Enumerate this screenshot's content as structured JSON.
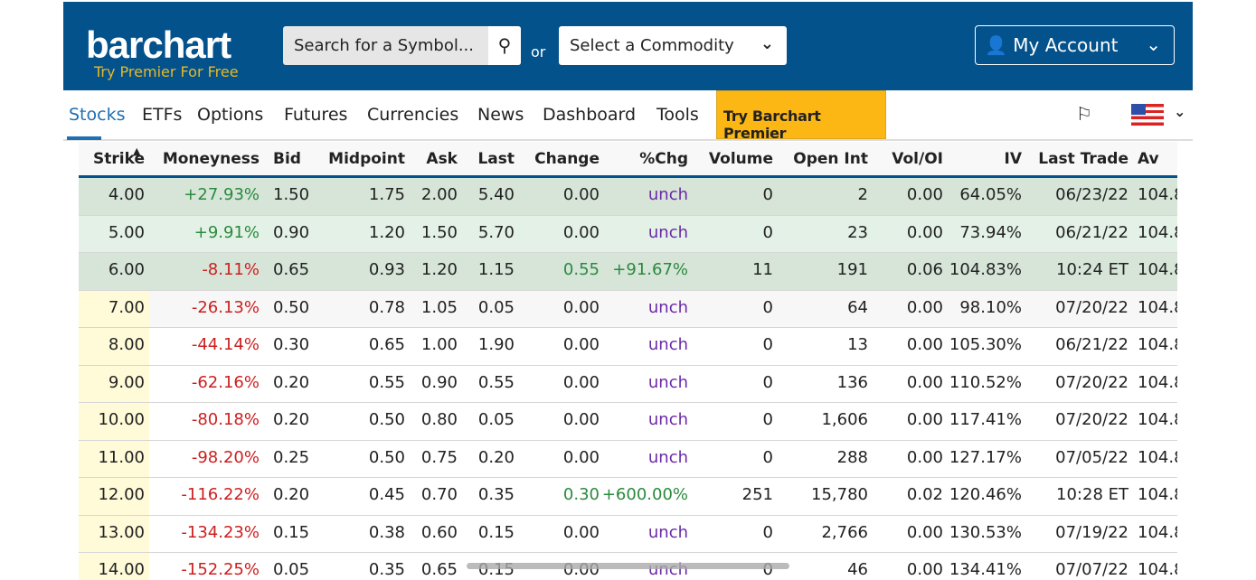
{
  "header": {
    "logo": "barchart",
    "tagline": "Try Premier For Free",
    "search_placeholder": "Search for a Symbol...",
    "or": "or",
    "commodity": "Select a Commodity",
    "account": "My Account"
  },
  "nav": {
    "items": [
      "Stocks",
      "ETFs",
      "Options",
      "Futures",
      "Currencies",
      "News",
      "Dashboard",
      "Tools"
    ],
    "premier": "Try Barchart Premier",
    "active": "Stocks"
  },
  "colors": {
    "brand": "#04528c",
    "premier": "#fdb714",
    "positive": "#2a8a3e",
    "negative": "#cc1f1f",
    "unch": "#6a2aa8"
  },
  "table": {
    "columns": [
      "Strike",
      "Moneyness",
      "Bid",
      "Midpoint",
      "Ask",
      "Last",
      "Change",
      "%Chg",
      "Volume",
      "Open Int",
      "Vol/OI",
      "IV",
      "Last Trade",
      "Av"
    ],
    "sort": "Strike ascending",
    "rows": [
      [
        "4.00",
        "+27.93%",
        "1.50",
        "1.75",
        "2.00",
        "5.40",
        "0.00",
        "unch",
        "0",
        "2",
        "0.00",
        "64.05%",
        "06/23/22",
        "104.8"
      ],
      [
        "5.00",
        "+9.91%",
        "0.90",
        "1.20",
        "1.50",
        "5.70",
        "0.00",
        "unch",
        "0",
        "23",
        "0.00",
        "73.94%",
        "06/21/22",
        "104.8"
      ],
      [
        "6.00",
        "-8.11%",
        "0.65",
        "0.93",
        "1.20",
        "1.15",
        "0.55",
        "+91.67%",
        "11",
        "191",
        "0.06",
        "104.83%",
        "10:24 ET",
        "104.8"
      ],
      [
        "7.00",
        "-26.13%",
        "0.50",
        "0.78",
        "1.05",
        "0.05",
        "0.00",
        "unch",
        "0",
        "64",
        "0.00",
        "98.10%",
        "07/20/22",
        "104.8"
      ],
      [
        "8.00",
        "-44.14%",
        "0.30",
        "0.65",
        "1.00",
        "1.90",
        "0.00",
        "unch",
        "0",
        "13",
        "0.00",
        "105.30%",
        "06/21/22",
        "104.8"
      ],
      [
        "9.00",
        "-62.16%",
        "0.20",
        "0.55",
        "0.90",
        "0.55",
        "0.00",
        "unch",
        "0",
        "136",
        "0.00",
        "110.52%",
        "07/20/22",
        "104.8"
      ],
      [
        "10.00",
        "-80.18%",
        "0.20",
        "0.50",
        "0.80",
        "0.05",
        "0.00",
        "unch",
        "0",
        "1,606",
        "0.00",
        "117.41%",
        "07/20/22",
        "104.8"
      ],
      [
        "11.00",
        "-98.20%",
        "0.25",
        "0.50",
        "0.75",
        "0.20",
        "0.00",
        "unch",
        "0",
        "288",
        "0.00",
        "127.17%",
        "07/05/22",
        "104.8"
      ],
      [
        "12.00",
        "-116.22%",
        "0.20",
        "0.45",
        "0.70",
        "0.35",
        "0.30",
        "+600.00%",
        "251",
        "15,780",
        "0.02",
        "120.46%",
        "10:28 ET",
        "104.8"
      ],
      [
        "13.00",
        "-134.23%",
        "0.15",
        "0.38",
        "0.60",
        "0.15",
        "0.00",
        "unch",
        "0",
        "2,766",
        "0.00",
        "130.53%",
        "07/19/22",
        "104.8"
      ],
      [
        "14.00",
        "-152.25%",
        "0.05",
        "0.35",
        "0.65",
        "0.15",
        "0.00",
        "unch",
        "0",
        "46",
        "0.00",
        "134.41%",
        "07/07/22",
        "104.8"
      ]
    ]
  }
}
